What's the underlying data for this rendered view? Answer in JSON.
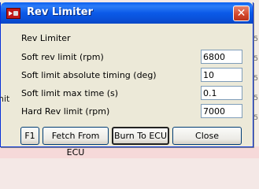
{
  "window": {
    "title": "Rev Limiter"
  },
  "dialog": {
    "section_title": "Rev Limiter",
    "fields": [
      {
        "label": "Soft rev limit (rpm)",
        "value": "6800"
      },
      {
        "label": "Soft limit absolute timing (deg)",
        "value": "10"
      },
      {
        "label": "Soft limit max time (s)",
        "value": "0.1"
      },
      {
        "label": "Hard Rev limit (rpm)",
        "value": "7000"
      }
    ]
  },
  "buttons": {
    "f1": "F1",
    "fetch": "Fetch From ECU",
    "burn": "Burn To ECU",
    "close": "Close"
  },
  "background": {
    "left_fragment": "nit",
    "right_fragments": [
      "5",
      "5",
      "5",
      "5",
      "5"
    ]
  },
  "icons": {
    "app": "app-icon",
    "close": "close-icon"
  }
}
